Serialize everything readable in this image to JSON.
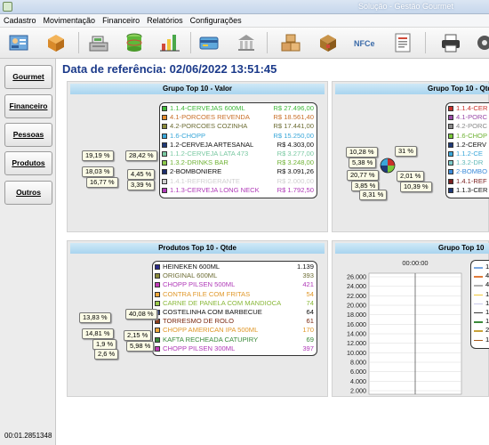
{
  "window": {
    "title": "Solução - Gestão Gourmet"
  },
  "menu": [
    "Cadastro",
    "Movimentação",
    "Financeiro",
    "Relatórios",
    "Configurações"
  ],
  "toolbar": {
    "nfce_label": "NFCe"
  },
  "nav": [
    "Gourmet",
    "Financeiro",
    "Pessoas",
    "Produtos",
    "Outros"
  ],
  "timer": "00:01.2851348",
  "ref_date": "Data de referência: 02/06/2022 13:51:45",
  "panels": {
    "grupo_valor": {
      "title": "Grupo Top 10 - Valor",
      "items": [
        {
          "label": "1.1.4-CERVEJAS 600ML",
          "value": "R$ 27.496,00",
          "color": "#3fb83a",
          "text_color": "#3fb83a"
        },
        {
          "label": "4.1-PORCOES REVENDA",
          "value": "R$ 18.561,40",
          "color": "#e48a2c",
          "text_color": "#c9702a"
        },
        {
          "label": "4.2-PORCOES COZINHA",
          "value": "R$ 17.441,00",
          "color": "#8a8a3a",
          "text_color": "#6d6d35"
        },
        {
          "label": "1.6-CHOPP",
          "value": "R$ 15.250,00",
          "color": "#3aa7d9",
          "text_color": "#3aa7d9"
        },
        {
          "label": "1.2-CERVEJA ARTESANAL",
          "value": "R$ 4.303,00",
          "color": "#1f3a78",
          "text_color": "#111111"
        },
        {
          "label": "1.1.2-CERVEJA LATA 473",
          "value": "R$ 3.277,00",
          "color": "#7ac9a2",
          "text_color": "#7ac9a2"
        },
        {
          "label": "1.3.2-DRINKS BAR",
          "value": "R$ 3.248,00",
          "color": "#8cc94a",
          "text_color": "#6fb235"
        },
        {
          "label": "2-BOMBONIERE",
          "value": "R$ 3.091,26",
          "color": "#1e2f6e",
          "text_color": "#111111"
        },
        {
          "label": "1.4.1-REFRIGERANTE",
          "value": "R$ 2.000,00",
          "color": "#d0d0d0",
          "text_color": "#d0d0d0"
        },
        {
          "label": "1.1.3-CERVEJA LONG NECK",
          "value": "R$ 1.792,50",
          "color": "#b03ab8",
          "text_color": "#b03ab8"
        }
      ],
      "pie_labels": [
        "19,19 %",
        "28,42 %",
        "18,03 %",
        "4,45 %",
        "16,77 %",
        "3,39 %"
      ]
    },
    "grupo_qtde": {
      "title": "Grupo Top 10 - Qtde",
      "items": [
        {
          "label": "1.1.4-CER",
          "color": "#c9302a",
          "text_color": "#c9302a"
        },
        {
          "label": "4.1-PORC",
          "color": "#9a4aa8",
          "text_color": "#9a4aa8"
        },
        {
          "label": "4.2-PORC",
          "color": "#8a8a8a",
          "text_color": "#8a8a8a"
        },
        {
          "label": "1.6-CHOP",
          "color": "#7ac93a",
          "text_color": "#6fb235"
        },
        {
          "label": "1.2-CERV",
          "color": "#1f3a78",
          "text_color": "#111111"
        },
        {
          "label": "1.1.2-CE",
          "color": "#3aa7d9",
          "text_color": "#3aa7d9"
        },
        {
          "label": "1.3.2-DR",
          "color": "#7ac9c9",
          "text_color": "#5fb8b8"
        },
        {
          "label": "2-BOMBO",
          "color": "#3a8ad9",
          "text_color": "#3a8ad9"
        },
        {
          "label": "1.4.1-REF",
          "color": "#7a1f1f",
          "text_color": "#7a1f1f"
        },
        {
          "label": "1.1.3-CER",
          "color": "#1f3a78",
          "text_color": "#111111"
        }
      ],
      "pie_labels": [
        "10,28 %",
        "31 %",
        "5,38 %",
        "20,77 %",
        "2,01 %",
        "3,85 %",
        "10,39 %",
        "8,31 %"
      ]
    },
    "produtos_qtde": {
      "title": "Produtos Top 10 - Qtde",
      "items": [
        {
          "label": "HEINEKEN 600ML",
          "value": "1.139",
          "color": "#2a2a8a",
          "text_color": "#111111"
        },
        {
          "label": "ORIGINAL 600ML",
          "value": "393",
          "color": "#8a8a3a",
          "text_color": "#6d6d35"
        },
        {
          "label": "CHOPP PILSEN 500ML",
          "value": "421",
          "color": "#c23ab8",
          "text_color": "#b03ab8"
        },
        {
          "label": "CONTRA FILE COM FRITAS",
          "value": "54",
          "color": "#f0a83a",
          "text_color": "#e0982a"
        },
        {
          "label": "CARNE DE PANELA COM MANDIOCA",
          "value": "74",
          "color": "#9ac94a",
          "text_color": "#8ab83a"
        },
        {
          "label": "COSTELINHA COM BARBECUE",
          "value": "64",
          "color": "#1e2f6e",
          "text_color": "#111111"
        },
        {
          "label": "TORRESMO DE ROLO",
          "value": "61",
          "color": "#8a3a1a",
          "text_color": "#7a2a12"
        },
        {
          "label": "CHOPP AMERICAN IPA 500ML",
          "value": "170",
          "color": "#f0a83a",
          "text_color": "#e0982a"
        },
        {
          "label": "KAFTA RECHEADA CATUPIRY",
          "value": "69",
          "color": "#3a8a3a",
          "text_color": "#3a8a3a"
        },
        {
          "label": "CHOPP PILSEN 300ML",
          "value": "397",
          "color": "#c23ab8",
          "text_color": "#b03ab8"
        }
      ],
      "pie_labels": [
        "13,83 %",
        "40,08 %",
        "14,81 %",
        "2,15 %",
        "1,9 %",
        "5,98 %",
        "2,6 %"
      ]
    },
    "grupo_line": {
      "title": "Grupo Top 10",
      "time_label": "00:00:00",
      "items": [
        {
          "label": "1.",
          "color": "#7aa7e0"
        },
        {
          "label": "4.",
          "color": "#e07a3a"
        },
        {
          "label": "4.",
          "color": "#b0b0b0"
        },
        {
          "label": "1.",
          "color": "#f0c83a"
        },
        {
          "label": "1.",
          "color": "#c9c9e9"
        },
        {
          "label": "1.",
          "color": "#3a3a3a"
        },
        {
          "label": "1.",
          "color": "#3a8a3a"
        },
        {
          "label": "2.",
          "color": "#c9a33a"
        },
        {
          "label": "1.",
          "color": "#a85a1a"
        }
      ]
    }
  },
  "chart_data": {
    "type": "line",
    "title": "Grupo Top 10",
    "x": [
      "00:00:00"
    ],
    "yticks": [
      "26.000",
      "24.000",
      "22.000",
      "20.000",
      "18.000",
      "16.000",
      "14.000",
      "12.000",
      "10.000",
      "8.000",
      "6.000",
      "4.000",
      "2.000"
    ],
    "ylim": [
      2000,
      26000
    ],
    "grid": true,
    "legend": "right"
  }
}
